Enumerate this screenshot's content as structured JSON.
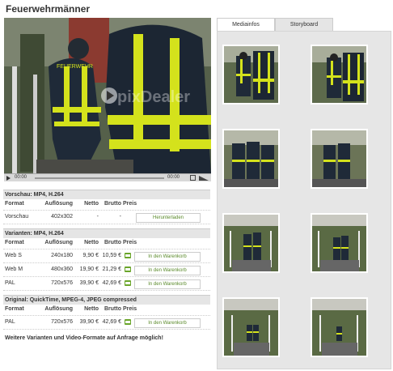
{
  "page": {
    "title": "Feuerwehrmänner"
  },
  "player": {
    "watermark": "pixDealer",
    "time_elapsed": "00:00",
    "time_total": "00:00",
    "controls": [
      "play-icon",
      "fullscreen-icon",
      "volume-icon"
    ]
  },
  "pricing": {
    "sections": [
      {
        "title": "Vorschau: MP4, H.264",
        "headers": {
          "format": "Format",
          "aufloesung": "Auflösung",
          "netto": "Netto",
          "brutto": "Brutto",
          "preis": "Preis"
        },
        "rows": [
          {
            "format": "Vorschau",
            "aufloesung": "402x302",
            "netto": "-",
            "brutto": "-",
            "button": "Herunterladen"
          }
        ]
      },
      {
        "title": "Varianten: MP4, H.264",
        "headers": {
          "format": "Format",
          "aufloesung": "Auflösung",
          "netto": "Netto",
          "brutto": "Brutto",
          "preis": "Preis"
        },
        "rows": [
          {
            "format": "Web S",
            "aufloesung": "240x180",
            "netto": "9,90 €",
            "brutto": "10,59 €",
            "button": "In den Warenkorb"
          },
          {
            "format": "Web M",
            "aufloesung": "480x360",
            "netto": "19,90 €",
            "brutto": "21,29 €",
            "button": "In den Warenkorb"
          },
          {
            "format": "PAL",
            "aufloesung": "720x576",
            "netto": "39,90 €",
            "brutto": "42,69 €",
            "button": "In den Warenkorb"
          }
        ]
      },
      {
        "title": "Original: QuickTime, MPEG-4, JPEG compressed",
        "headers": {
          "format": "Format",
          "aufloesung": "Auflösung",
          "netto": "Netto",
          "brutto": "Brutto",
          "preis": "Preis"
        },
        "rows": [
          {
            "format": "PAL",
            "aufloesung": "720x576",
            "netto": "39,90 €",
            "brutto": "42,69 €",
            "button": "In den Warenkorb"
          }
        ]
      }
    ],
    "note": "Weitere Varianten und Video-Formate auf Anfrage möglich!"
  },
  "tabs": [
    {
      "label": "Mediainfos",
      "active": false
    },
    {
      "label": "Storyboard",
      "active": true
    }
  ],
  "storyboard": {
    "frame_count": 8,
    "frames": [
      "two-firefighters-close",
      "two-firefighters-close",
      "three-firefighters-walking",
      "three-firefighters-walking",
      "firefighters-on-bridge",
      "firefighters-on-bridge",
      "firefighters-far-on-bridge",
      "firefighters-far-on-bridge"
    ]
  },
  "colors": {
    "accent_green": "#6aa52a",
    "panel_bg": "#e6e6e6",
    "section_bg": "#e5e5e5"
  }
}
